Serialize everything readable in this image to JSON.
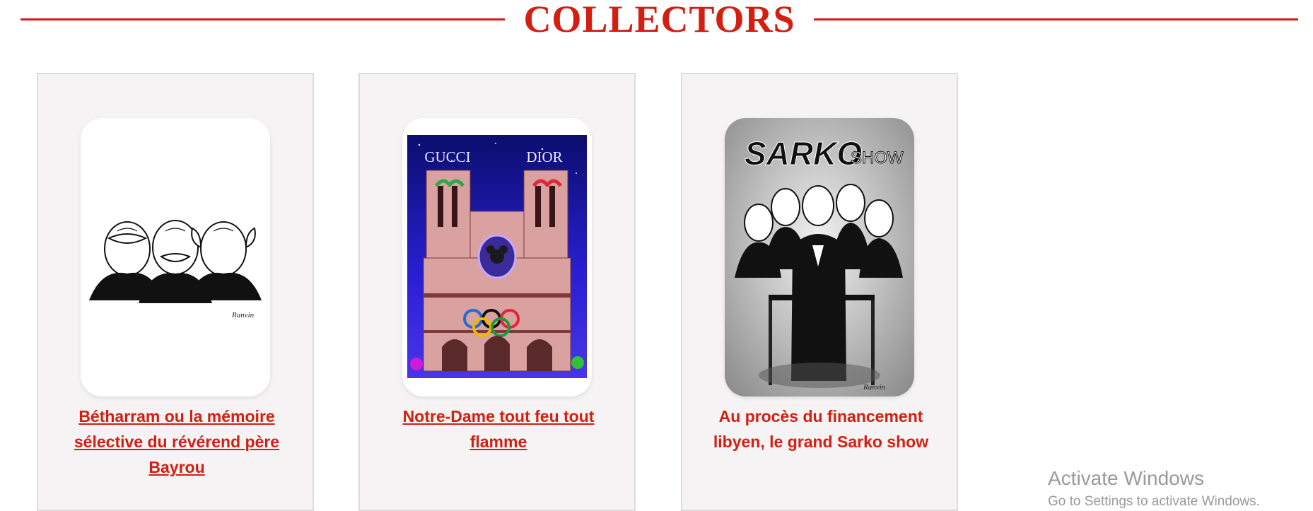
{
  "section": {
    "title": "COLLECTORS"
  },
  "cards": [
    {
      "title": "Bétharram ou la mémoire sélective du révérend père Bayrou",
      "image_icon": "three-wise-monkeys-caricature"
    },
    {
      "title": "Notre-Dame tout feu tout flamme",
      "image_icon": "notre-dame-cathedral-illustration",
      "image_labels": {
        "left": "GUCCI",
        "right": "DIOR"
      }
    },
    {
      "title": "Au procès du financement libyen, le grand Sarko show",
      "image_icon": "sarko-show-caricature",
      "image_labels": {
        "headline": "SARKO",
        "sub": "SHOW"
      }
    }
  ],
  "watermark": {
    "title": "Activate Windows",
    "subtitle": "Go to Settings to activate Windows."
  },
  "colors": {
    "accent": "#d31f12",
    "card_bg": "#f6f3f4",
    "card_border": "#dcdcdc"
  }
}
